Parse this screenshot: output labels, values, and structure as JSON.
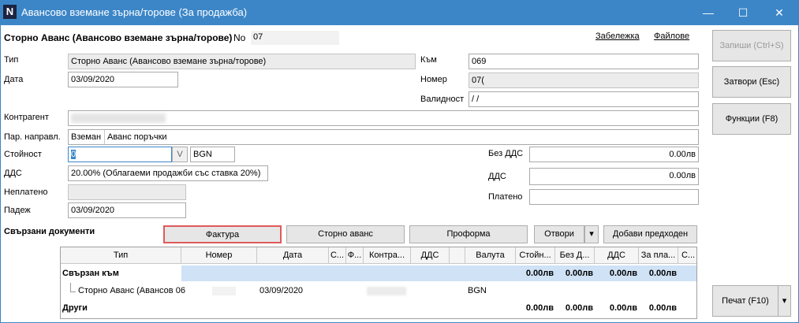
{
  "window": {
    "logo_letter": "N",
    "title": "Авансово вземане зърна/торове (За продажба)",
    "controls": {
      "minimize": "—",
      "maximize": "☐",
      "close": "✕"
    }
  },
  "header": {
    "doc_title": "Сторно Аванс (Авансово вземане зърна/торове)",
    "no_label": "No",
    "no_value": "07",
    "note_link": "Забележка",
    "files_link": "Файлове"
  },
  "form": {
    "type_label": "Тип",
    "type_value": "Сторно Аванс (Авансово вземане зърна/торове)",
    "date_label": "Дата",
    "date_value": "03/09/2020",
    "to_label": "Към",
    "to_value": "069",
    "number_label": "Номер",
    "number_value": "07(",
    "validity_label": "Валидност",
    "validity_value": " /  /",
    "contractor_label": "Контрагент",
    "contractor_value": "",
    "direction_label": "Пар. направл.",
    "direction_code": "Вземан",
    "direction_value": "Аванс поръчки",
    "value_label": "Стойност",
    "value_value": "0",
    "value_dropdown": "V",
    "currency_value": "BGN",
    "vat_label": "ДДС",
    "vat_value": "20.00% (Облагаеми продажби със ставка 20%)",
    "unpaid_label": "Неплатено",
    "unpaid_value": "",
    "due_label": "Падеж",
    "due_value": "03/09/2020",
    "no_vat_label": "Без ДДС",
    "no_vat_value": "0.00лв",
    "vat2_label": "ДДС",
    "vat2_value": "0.00лв",
    "paid_label": "Платено",
    "paid_value": ""
  },
  "side_buttons": {
    "save": "Запиши (Ctrl+S)",
    "close": "Затвори (Esc)",
    "functions": "Функции (F8)",
    "print": "Печат (F10)",
    "print_arrow": "▾"
  },
  "related": {
    "title": "Свързани документи",
    "buttons": {
      "invoice": "Фактура",
      "storno_advance": "Сторно аванс",
      "proforma": "Проформа",
      "open": "Отвори",
      "open_arrow": "▾",
      "add_previous": "Добави предходен"
    },
    "columns": [
      "Тип",
      "Номер",
      "Дата",
      "С...",
      "Ф...",
      "Контра...",
      "ДДС",
      "",
      "Валута",
      "Стойн...",
      "Без Д...",
      "ДДС",
      "За пла...",
      "С..."
    ],
    "group1": {
      "label": "Свързан към",
      "totals": [
        "0.00лв",
        "0.00лв",
        "0.00лв",
        "0.00лв"
      ]
    },
    "row1": {
      "type": "Сторно Аванс (Авансов 06",
      "date": "03/09/2020",
      "currency": "BGN"
    },
    "group2": {
      "label": "Други",
      "totals": [
        "0.00лв",
        "0.00лв",
        "0.00лв",
        "0.00лв"
      ]
    }
  },
  "colors": {
    "titlebar": "#3c86c8",
    "highlight_row": "#cfe2f6",
    "invoice_outline": "#e05a5a"
  }
}
